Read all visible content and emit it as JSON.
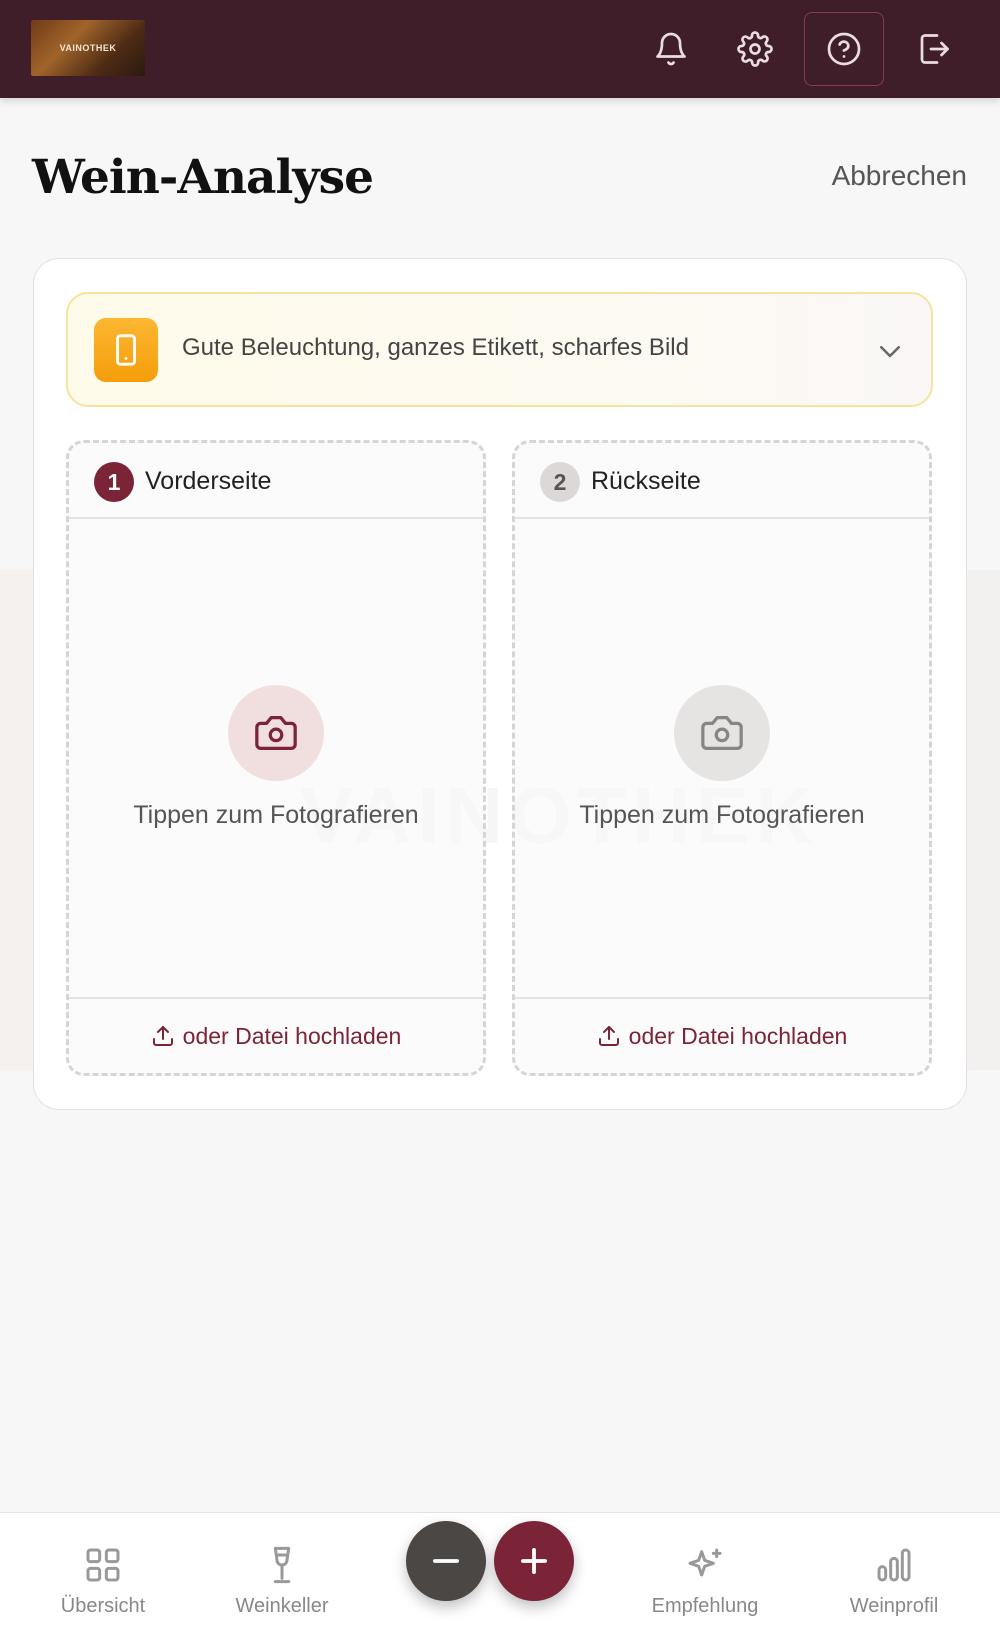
{
  "app": {
    "logo_text": "VAINOTHEK",
    "colors": {
      "primary": "#3f1e2a",
      "accent": "#7b2437",
      "warning": "#f59e0b"
    }
  },
  "topbar": {
    "icons": [
      "bell-icon",
      "gear-icon",
      "help-circle-icon",
      "logout-icon"
    ],
    "active_icon": "help-circle-icon"
  },
  "header": {
    "title": "Wein-Analyse",
    "cancel_label": "Abbrechen"
  },
  "hint": {
    "icon": "phone-icon",
    "text": "Gute Beleuchtung, ganzes Etikett, scharfes Bild"
  },
  "uploads": [
    {
      "number": "1",
      "label": "Vorderseite",
      "tap_text": "Tippen zum Fotografieren",
      "upload_text": "oder Datei hochladen",
      "active": true
    },
    {
      "number": "2",
      "label": "Rückseite",
      "tap_text": "Tippen zum Fotografieren",
      "upload_text": "oder Datei hochladen",
      "active": false
    }
  ],
  "bottom_nav": {
    "items": [
      {
        "label": "Übersicht",
        "icon": "grid-icon"
      },
      {
        "label": "Weinkeller",
        "icon": "wine-glass-icon"
      },
      {
        "label": "Empfehlung",
        "icon": "sparkles-icon"
      },
      {
        "label": "Weinprofil",
        "icon": "bar-chart-icon"
      }
    ],
    "fab_minus": "minus-icon",
    "fab_plus": "plus-icon"
  }
}
